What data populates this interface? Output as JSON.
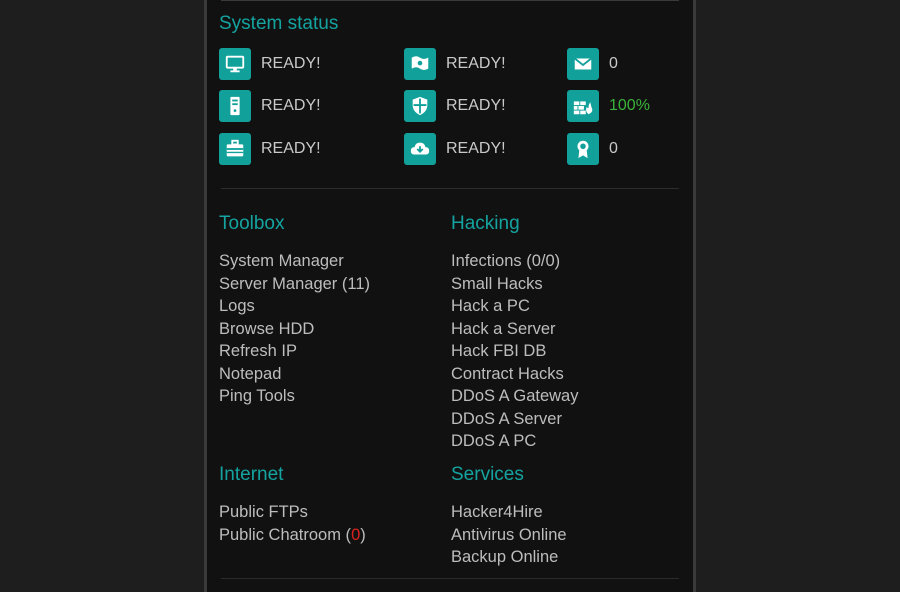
{
  "system_status": {
    "title": "System status",
    "items": [
      {
        "icon": "monitor-icon",
        "value": "READY!",
        "color": "default"
      },
      {
        "icon": "flag-icon",
        "value": "READY!",
        "color": "default"
      },
      {
        "icon": "mail-icon",
        "value": "0",
        "color": "default"
      },
      {
        "icon": "server-icon",
        "value": "READY!",
        "color": "default"
      },
      {
        "icon": "shield-icon",
        "value": "READY!",
        "color": "default"
      },
      {
        "icon": "firewall-icon",
        "value": "100%",
        "color": "#3bb33b"
      },
      {
        "icon": "toolbox-icon",
        "value": "READY!",
        "color": "default"
      },
      {
        "icon": "cloud-download-icon",
        "value": "READY!",
        "color": "default"
      },
      {
        "icon": "badge-icon",
        "value": "0",
        "color": "default"
      }
    ]
  },
  "toolbox": {
    "title": "Toolbox",
    "items": [
      "System Manager",
      "Server Manager (11)",
      "Logs",
      "Browse HDD",
      "Refresh IP",
      "Notepad",
      "Ping Tools"
    ]
  },
  "hacking": {
    "title": "Hacking",
    "items": [
      "Infections (0/0)",
      "Small Hacks",
      "Hack a PC",
      "Hack a Server",
      "Hack FBI DB",
      "Contract Hacks",
      "DDoS A Gateway",
      "DDoS A Server",
      "DDoS A PC"
    ]
  },
  "internet": {
    "title": "Internet",
    "items": [
      "Public FTPs"
    ],
    "chatroom": {
      "label": "Public Chatroom (",
      "count": "0",
      "close": ")"
    }
  },
  "services": {
    "title": "Services",
    "items": [
      "Hacker4Hire",
      "Antivirus Online",
      "Backup Online"
    ]
  },
  "colors": {
    "accent": "#14a3a0",
    "icon_bg": "#12a19a",
    "ok": "#3bb33b",
    "alert": "#d9231f"
  }
}
